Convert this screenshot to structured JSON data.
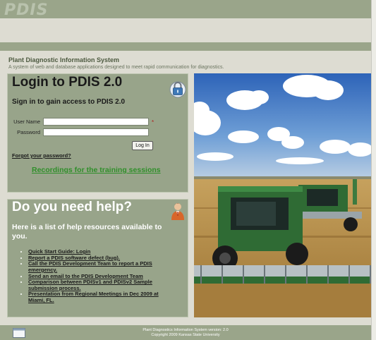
{
  "header": {
    "logo_text": "PDIS"
  },
  "system": {
    "title": "Plant Diagnostic Information System",
    "subtitle": "A system of web and database applications designed to meet rapid communication for diagnostics."
  },
  "login": {
    "title": "Login to PDIS 2.0",
    "subtitle": "Sign in to gain access to PDIS 2.0",
    "username_label": "User Name",
    "username_value": "",
    "password_label": "Password",
    "password_value": "",
    "required_mark": "*",
    "button_label": "Log In",
    "forgot_link": "Forgot your password?",
    "recordings_link": "Recordings for the training sessions"
  },
  "help": {
    "title": "Do you need help?",
    "subtitle": "Here is a list of help resources available to you.",
    "links": [
      "Quick Start Guide: Login",
      "Report a PDIS software defect (bug).",
      "Call the PDIS Development Team to report a PDIS emergency.",
      "Send an email to the PDIS Development Team",
      "Comparison between PDISv1 and PDISv2 Sample submission process.",
      "Presentation from Regional Meetings in Dec 2009 at Miami, FL."
    ]
  },
  "footer": {
    "version_text": "Plant Diagnostics Information System version: 2.0",
    "copyright_text": "Copyright 2009 Kansas State University"
  },
  "colors": {
    "header_band": "#9aa58a",
    "panel": "#98a48a",
    "page_background": "#dddcd2",
    "link_green": "#2f8f2a"
  },
  "icons": [
    "lock-icon",
    "help-person-icon",
    "window-icon"
  ]
}
